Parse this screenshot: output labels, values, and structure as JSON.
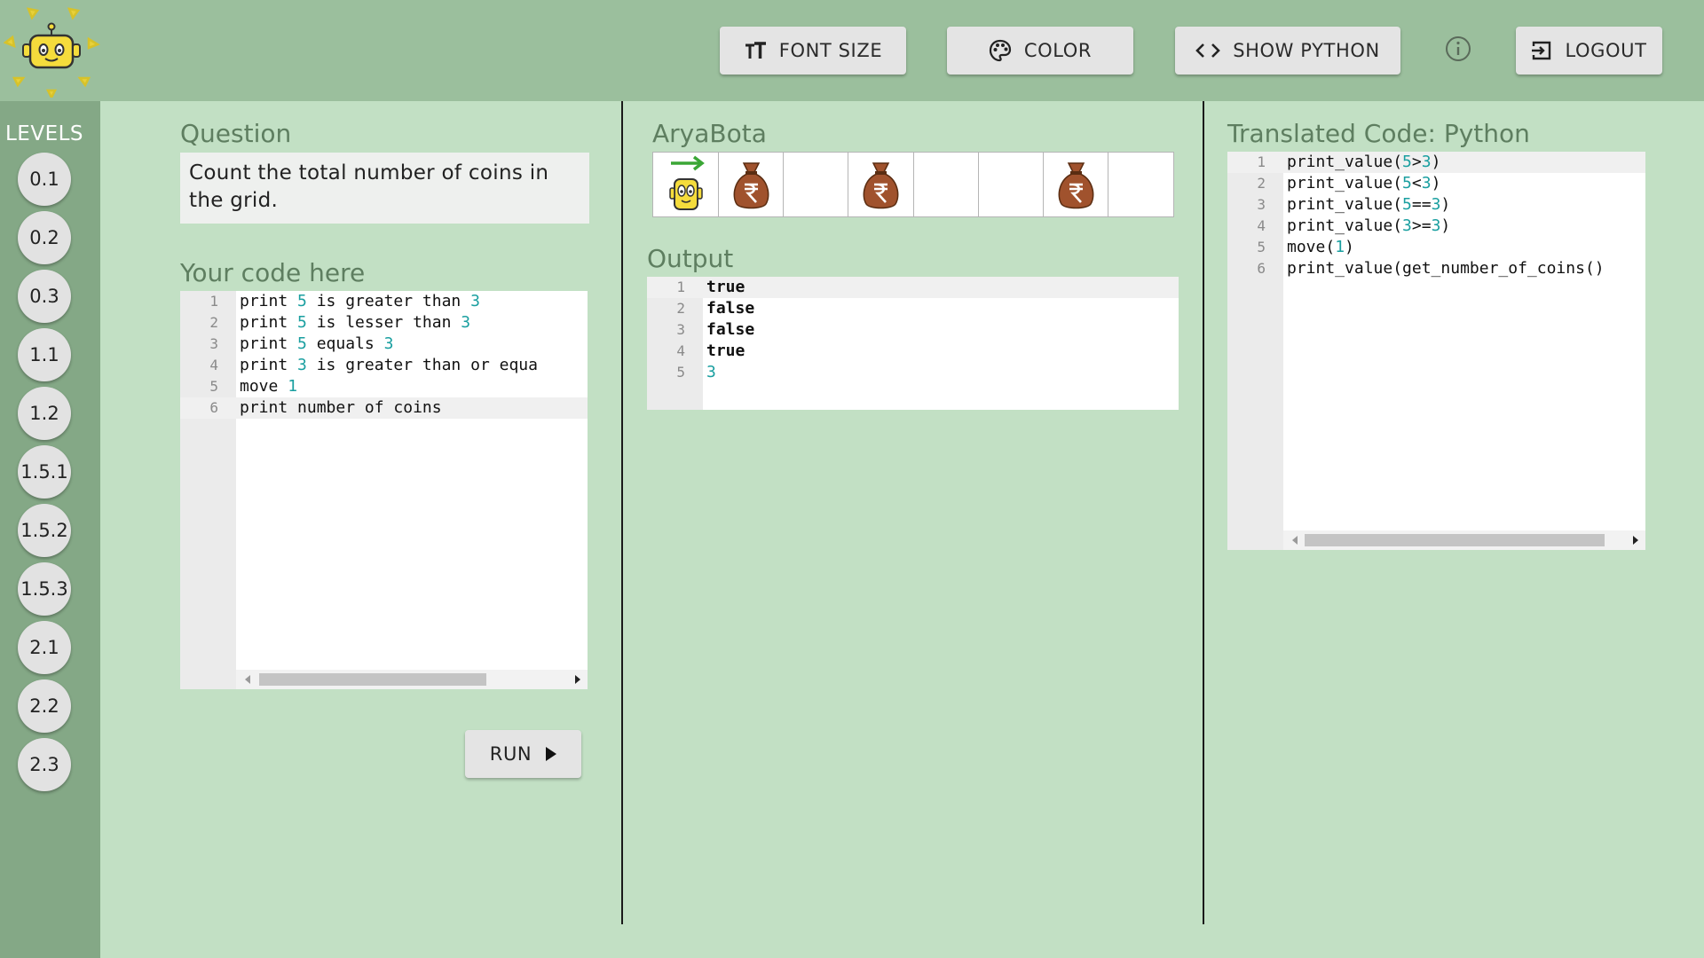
{
  "header": {
    "buttons": {
      "font_size": "FONT SIZE",
      "color": "COLOR",
      "show_python": "SHOW PYTHON",
      "logout": "LOGOUT"
    }
  },
  "sidebar": {
    "title": "LEVELS",
    "levels": [
      "0.1",
      "0.2",
      "0.3",
      "1.1",
      "1.2",
      "1.5.1",
      "1.5.2",
      "1.5.3",
      "2.1",
      "2.2",
      "2.3"
    ]
  },
  "question": {
    "label": "Question",
    "text": "Count the total number of coins in the grid."
  },
  "code_editor": {
    "label": "Your code here",
    "lines": [
      [
        {
          "t": "print "
        },
        {
          "t": "5",
          "n": true
        },
        {
          "t": " is greater than "
        },
        {
          "t": "3",
          "n": true
        }
      ],
      [
        {
          "t": "print "
        },
        {
          "t": "5",
          "n": true
        },
        {
          "t": " is lesser than "
        },
        {
          "t": "3",
          "n": true
        }
      ],
      [
        {
          "t": "print "
        },
        {
          "t": "5",
          "n": true
        },
        {
          "t": " equals "
        },
        {
          "t": "3",
          "n": true
        }
      ],
      [
        {
          "t": "print "
        },
        {
          "t": "3",
          "n": true
        },
        {
          "t": " is greater than or equa"
        }
      ],
      [
        {
          "t": "move "
        },
        {
          "t": "1",
          "n": true
        }
      ],
      [
        {
          "t": "print number of coins"
        }
      ]
    ],
    "active_line": 6
  },
  "run_button": "RUN",
  "aryabota": {
    "label": "AryaBota",
    "cells": [
      "robot",
      "coin",
      "",
      "coin",
      "",
      "",
      "coin",
      ""
    ]
  },
  "output": {
    "label": "Output",
    "lines": [
      [
        {
          "t": "true",
          "b": true
        }
      ],
      [
        {
          "t": "false",
          "b": true
        }
      ],
      [
        {
          "t": "false",
          "b": true
        }
      ],
      [
        {
          "t": "true",
          "b": true
        }
      ],
      [
        {
          "t": "3",
          "n": true
        }
      ]
    ],
    "active_line": 1
  },
  "python": {
    "label": "Translated Code: Python",
    "lines": [
      [
        {
          "t": "print_value("
        },
        {
          "t": "5",
          "n": true
        },
        {
          "t": ">"
        },
        {
          "t": "3",
          "n": true
        },
        {
          "t": ")"
        }
      ],
      [
        {
          "t": "print_value("
        },
        {
          "t": "5",
          "n": true
        },
        {
          "t": "<"
        },
        {
          "t": "3",
          "n": true
        },
        {
          "t": ")"
        }
      ],
      [
        {
          "t": "print_value("
        },
        {
          "t": "5",
          "n": true
        },
        {
          "t": "=="
        },
        {
          "t": "3",
          "n": true
        },
        {
          "t": ")"
        }
      ],
      [
        {
          "t": "print_value("
        },
        {
          "t": "3",
          "n": true
        },
        {
          "t": ">="
        },
        {
          "t": "3",
          "n": true
        },
        {
          "t": ")"
        }
      ],
      [
        {
          "t": "move("
        },
        {
          "t": "1",
          "n": true
        },
        {
          "t": ")"
        }
      ],
      [
        {
          "t": "print_value(get_number_of_coins()"
        }
      ]
    ],
    "active_line": 1
  },
  "colors": {
    "header_bg": "#9bbf9d",
    "sidebar_bg": "#84a886",
    "main_bg": "#c2e0c4",
    "label_text": "#5e7e60",
    "number_highlight": "#1a9fa0",
    "coin_bag": "#a0522d"
  },
  "icons": {
    "logo": "sun-robot-logo",
    "font_size": "text-size-icon",
    "color": "palette-icon",
    "show_python": "code-icon",
    "info": "info-icon",
    "logout": "logout-icon",
    "run": "play-icon",
    "coin": "rupee-money-bag-icon",
    "robot": "robot-icon",
    "direction": "arrow-right-icon"
  }
}
